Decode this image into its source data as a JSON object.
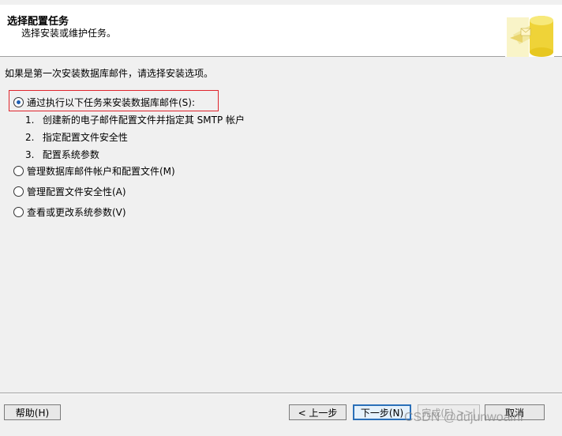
{
  "header": {
    "title": "选择配置任务",
    "subtitle": "选择安装或维护任务。"
  },
  "intro_text": "如果是第一次安装数据库邮件，请选择安装选项。",
  "options": [
    {
      "label": "通过执行以下任务来安装数据库邮件(S):",
      "checked": true
    },
    {
      "label": "管理数据库邮件帐户和配置文件(M)",
      "checked": false
    },
    {
      "label": "管理配置文件安全性(A)",
      "checked": false
    },
    {
      "label": "查看或更改系统参数(V)",
      "checked": false
    }
  ],
  "steps": [
    {
      "num": "1.",
      "text": "创建新的电子邮件配置文件并指定其 SMTP 帐户"
    },
    {
      "num": "2.",
      "text": "指定配置文件安全性"
    },
    {
      "num": "3.",
      "text": "配置系统参数"
    }
  ],
  "buttons": {
    "help": "帮助(H)",
    "back": "< 上一步",
    "next": "下一步(N)",
    "finish": "完成(F) >>|",
    "cancel": "取消"
  },
  "watermark": "CSDN @dujunwoaini",
  "colors": {
    "highlight_border": "#e0242c",
    "radio_dot": "#1e5fb4",
    "default_button": "#2a6fb8"
  }
}
